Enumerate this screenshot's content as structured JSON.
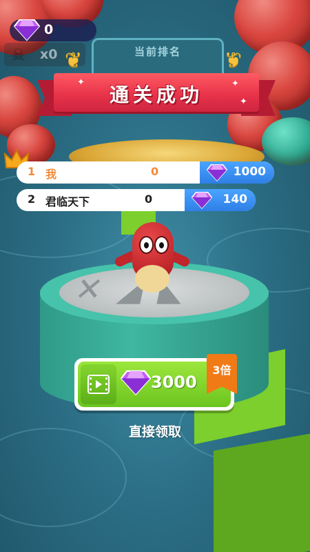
{
  "hud": {
    "gem_count": "0",
    "death_count": "x0"
  },
  "rank_board": {
    "label": "当前排名"
  },
  "banner": {
    "title": "通关成功"
  },
  "leaderboard": [
    {
      "rank": "1",
      "name": "我",
      "score": "0",
      "reward": "1000",
      "highlight": true
    },
    {
      "rank": "2",
      "name": "君临天下",
      "score": "0",
      "reward": "140",
      "highlight": false
    }
  ],
  "claim_button": {
    "amount": "3000",
    "multiplier": "3倍"
  },
  "direct_claim": {
    "label": "直接领取"
  },
  "colors": {
    "banner_red": "#e8344a",
    "reward_blue": "#2f7fe6",
    "claim_green": "#6cc51f",
    "multiplier_orange": "#f07a16",
    "gem_purple": "#b44bef"
  },
  "icons": [
    "diamond-gem-icon",
    "skull-icon",
    "crown-icon",
    "video-play-icon",
    "laurel-icon"
  ]
}
